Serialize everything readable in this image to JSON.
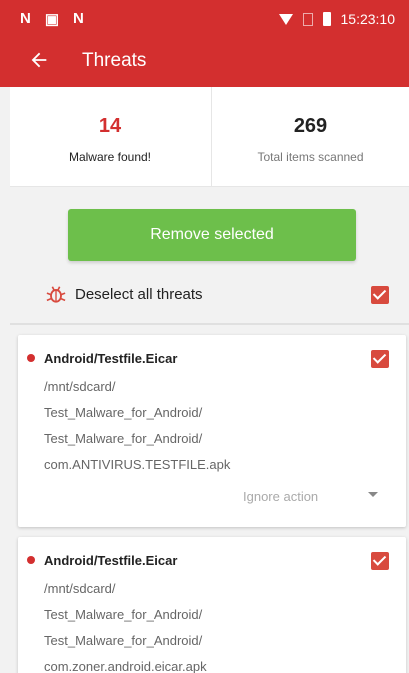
{
  "status_bar": {
    "left_icons": [
      "N",
      "▣",
      "N"
    ],
    "time": "15:23:10",
    "icons": [
      "wifi-icon",
      "sim-icon",
      "battery-icon"
    ]
  },
  "app_bar": {
    "title": "Threats",
    "back_icon": "arrow-left-icon"
  },
  "stats": {
    "malware_count": "14",
    "malware_label": "Malware found!",
    "scanned_count": "269",
    "scanned_label": "Total items scanned"
  },
  "remove_button": "Remove selected",
  "deselect": {
    "label": "Deselect all threats",
    "icon": "bug-icon",
    "checked": true
  },
  "threats": [
    {
      "name": "Android/Testfile.Eicar",
      "path": [
        "/mnt/sdcard/",
        "Test_Malware_for_Android/",
        "Test_Malware_for_Android/",
        "com.ANTIVIRUS.TESTFILE.apk"
      ],
      "action": "Ignore action",
      "checked": true
    },
    {
      "name": "Android/Testfile.Eicar",
      "path": [
        "/mnt/sdcard/",
        "Test_Malware_for_Android/",
        "Test_Malware_for_Android/",
        "com.zoner.android.eicar.apk"
      ],
      "checked": true
    }
  ],
  "colors": {
    "brand_red": "#d32f2f",
    "button_green": "#6dbf4b",
    "checkbox_red": "#d84a3e"
  }
}
